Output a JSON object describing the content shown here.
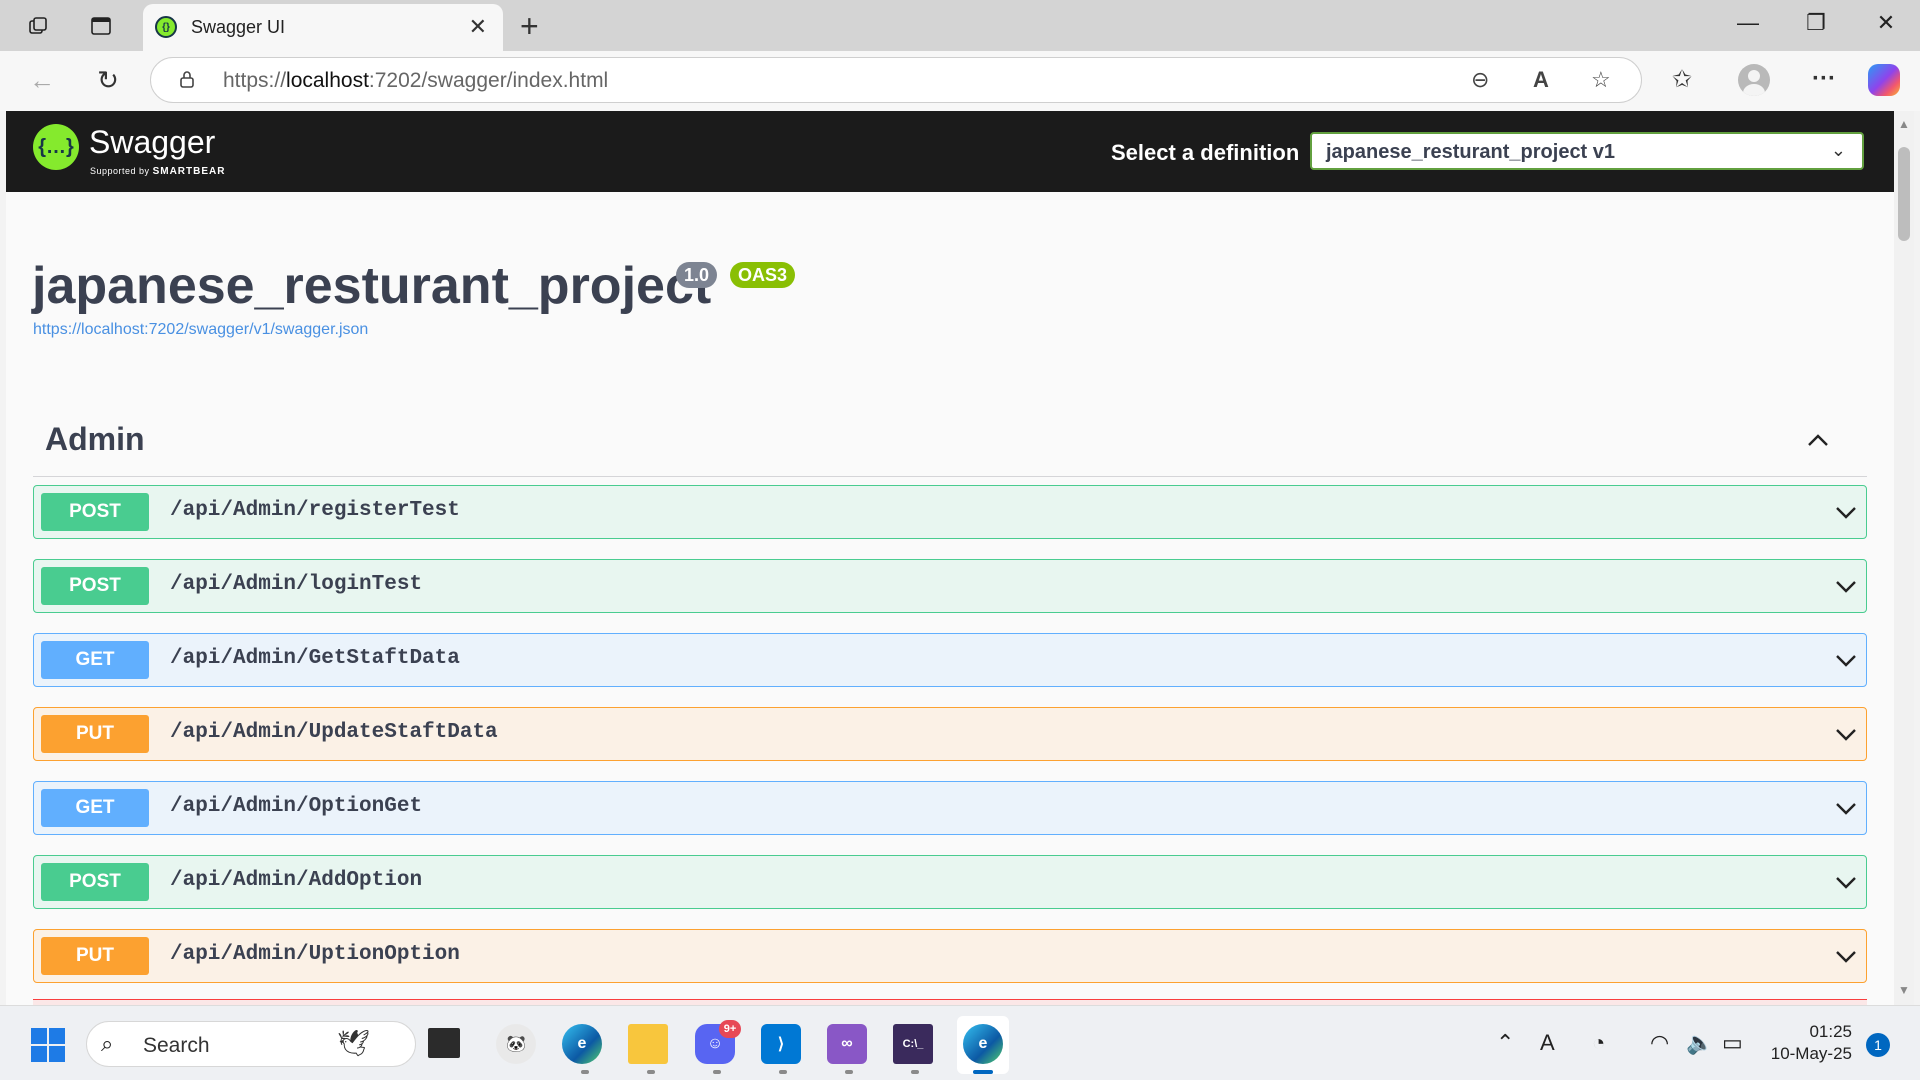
{
  "browser": {
    "tab_title": "Swagger UI",
    "url_prefix": "https://",
    "url_host": "localhost",
    "url_rest": ":7202/swagger/index.html"
  },
  "swagger": {
    "brand": "Swagger",
    "brand_supported": "Supported by",
    "brand_company": "SMARTBEAR",
    "select_label": "Select a definition",
    "select_value": "japanese_resturant_project v1",
    "api_title": "japanese_resturant_project",
    "version_badge": "1.0",
    "oas_badge": "OAS3",
    "spec_url": "https://localhost:7202/swagger/v1/swagger.json",
    "tag": "Admin",
    "operations": [
      {
        "method": "POST",
        "path": "/api/Admin/registerTest"
      },
      {
        "method": "POST",
        "path": "/api/Admin/loginTest"
      },
      {
        "method": "GET",
        "path": "/api/Admin/GetStaftData"
      },
      {
        "method": "PUT",
        "path": "/api/Admin/UpdateStaftData"
      },
      {
        "method": "GET",
        "path": "/api/Admin/OptionGet"
      },
      {
        "method": "POST",
        "path": "/api/Admin/AddOption"
      },
      {
        "method": "PUT",
        "path": "/api/Admin/UptionOption"
      }
    ],
    "colors": {
      "post": "#49cc90",
      "get": "#61affe",
      "put": "#fca130",
      "delete": "#f93e3e"
    }
  },
  "taskbar": {
    "search_placeholder": "Search",
    "discord_badge": "9+",
    "time": "01:25",
    "date": "10-May-25",
    "notification_count": "1"
  }
}
